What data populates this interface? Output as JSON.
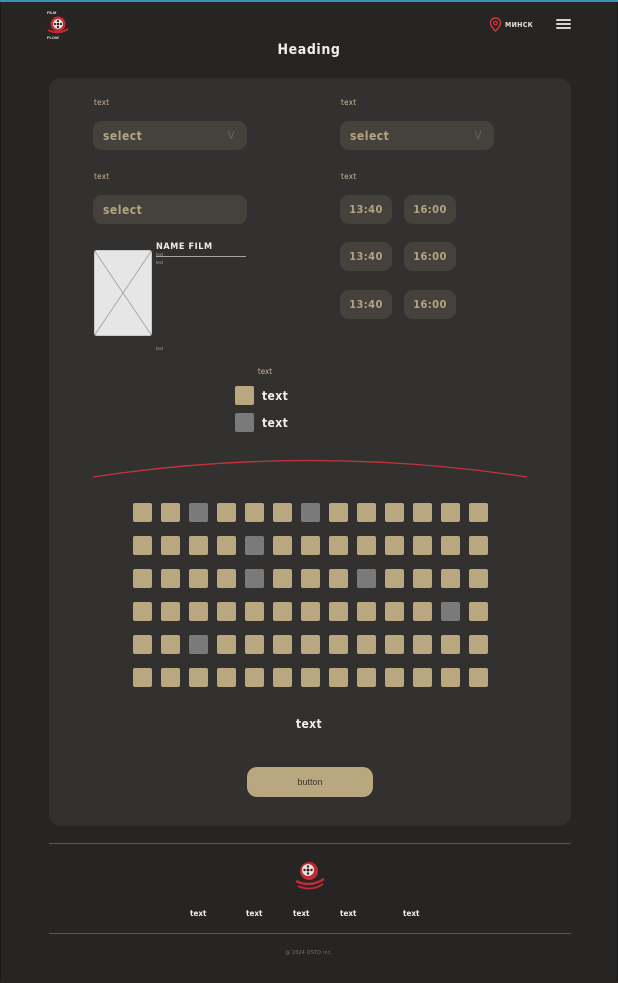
{
  "header": {
    "brand_top": "FILM",
    "brand_bottom": "FLOW",
    "city": "МИНСК",
    "heading": "Heading"
  },
  "filters": {
    "label_1": "text",
    "select_1": "select",
    "label_2": "text",
    "select_2": "select",
    "label_3": "text",
    "select_3": "select",
    "label_times": "text",
    "times": [
      "13:40",
      "16:00",
      "13:40",
      "16:00",
      "13:40",
      "16:00"
    ]
  },
  "film": {
    "name": "NAME FILM",
    "detail_1": "text",
    "detail_2": "text",
    "detail_3": "text"
  },
  "legend": {
    "title": "text",
    "free_label": "text",
    "taken_label": "text"
  },
  "hall": {
    "rows": 6,
    "cols": 13,
    "taken": [
      [
        0,
        2
      ],
      [
        0,
        6
      ],
      [
        1,
        4
      ],
      [
        2,
        4
      ],
      [
        2,
        8
      ],
      [
        3,
        11
      ],
      [
        4,
        2
      ]
    ]
  },
  "summary": "text",
  "button_label": "button",
  "footer": {
    "links": [
      "text",
      "text",
      "text",
      "text",
      "text"
    ],
    "copyright": "@ 2024 OSTO inc."
  },
  "colors": {
    "background": "#272424",
    "card": "#333030",
    "field": "#45413d",
    "accent": "#b9a87f",
    "seat_taken": "#7a7a7a",
    "screen": "#c4353b"
  }
}
